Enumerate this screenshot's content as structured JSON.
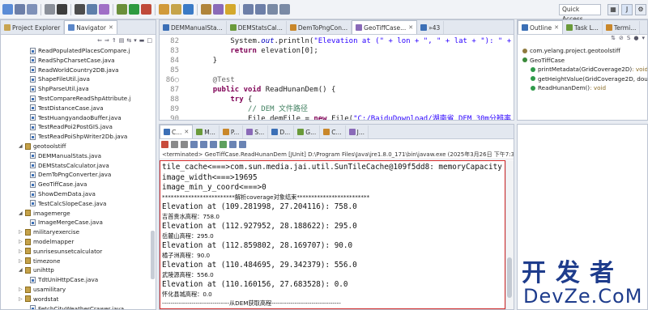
{
  "toolbar": {
    "quick_access": "Quick Access"
  },
  "left_panel": {
    "tabs": [
      {
        "label": "Project Explorer",
        "close": ""
      },
      {
        "label": "Navigator",
        "close": "✕"
      }
    ],
    "tree": [
      {
        "label": "ReadPopulatedPlacesCompare.j",
        "kind": "file",
        "indent": 1
      },
      {
        "label": "ReadShpCharsetCase.java",
        "kind": "file",
        "indent": 1
      },
      {
        "label": "ReadWorldCountry2DB.java",
        "kind": "file",
        "indent": 1
      },
      {
        "label": "ShapeFileUtil.java",
        "kind": "file",
        "indent": 1
      },
      {
        "label": "ShpParseUtil.java",
        "kind": "file",
        "indent": 1
      },
      {
        "label": "TestCompareReadShpAttribute.j",
        "kind": "file",
        "indent": 1
      },
      {
        "label": "TestDistanceCase.java",
        "kind": "file",
        "indent": 1
      },
      {
        "label": "TestHuangyandaoBuffer.java",
        "kind": "file",
        "indent": 1
      },
      {
        "label": "TestReadPoi2PostGIS.java",
        "kind": "file",
        "indent": 1
      },
      {
        "label": "TestReadPoiShpWriter2Db.java",
        "kind": "file",
        "indent": 1
      },
      {
        "label": "geotoolstiff",
        "kind": "folder-open",
        "indent": 0
      },
      {
        "label": "DEMManualStats.java",
        "kind": "file",
        "indent": 1
      },
      {
        "label": "DEMStatsCalculator.java",
        "kind": "file",
        "indent": 1
      },
      {
        "label": "DemToPngConverter.java",
        "kind": "file",
        "indent": 1
      },
      {
        "label": "GeoTiffCase.java",
        "kind": "file",
        "indent": 1
      },
      {
        "label": "ShowDemData.java",
        "kind": "file",
        "indent": 1
      },
      {
        "label": "TestCalcSlopeCase.java",
        "kind": "file",
        "indent": 1
      },
      {
        "label": "imagemerge",
        "kind": "folder-open",
        "indent": 0
      },
      {
        "label": "ImageMergeCase.java",
        "kind": "file",
        "indent": 1
      },
      {
        "label": "militaryexercise",
        "kind": "folder",
        "indent": 0
      },
      {
        "label": "modelmapper",
        "kind": "folder",
        "indent": 0
      },
      {
        "label": "sunrisesunsetcalculator",
        "kind": "folder",
        "indent": 0
      },
      {
        "label": "timezone",
        "kind": "folder",
        "indent": 0
      },
      {
        "label": "unihttp",
        "kind": "folder-open",
        "indent": 0
      },
      {
        "label": "TdtUniHttpCase.java",
        "kind": "file",
        "indent": 1
      },
      {
        "label": "usamilitary",
        "kind": "folder",
        "indent": 0
      },
      {
        "label": "wordstat",
        "kind": "folder",
        "indent": 0
      },
      {
        "label": "FetchCityWeatherCrawer.java",
        "kind": "file",
        "indent": 1
      }
    ]
  },
  "editor": {
    "tabs": [
      {
        "label": "DEMManualSta...",
        "close": ""
      },
      {
        "label": "DEMStatsCal...",
        "close": ""
      },
      {
        "label": "DemToPngCon...",
        "close": ""
      },
      {
        "label": "GeoTiffCase...",
        "close": "✕"
      },
      {
        "label": "»43",
        "close": ""
      }
    ],
    "lines": [
      {
        "n": "82",
        "parts": [
          [
            "",
            "        System."
          ],
          [
            "fld",
            "out"
          ],
          [
            "",
            ".println("
          ],
          [
            "str",
            "\"Elevation at (\" + lon + \", \" + lat + \"): \" +"
          ]
        ]
      },
      {
        "n": "83",
        "parts": [
          [
            "",
            "        "
          ],
          [
            "kw",
            "return"
          ],
          [
            "",
            " elevation[0];"
          ]
        ]
      },
      {
        "n": "84",
        "parts": [
          [
            "",
            "    }"
          ]
        ]
      },
      {
        "n": "85",
        "parts": [
          [
            "",
            ""
          ]
        ]
      },
      {
        "n": "86○",
        "parts": [
          [
            "ann",
            "    @Test"
          ]
        ]
      },
      {
        "n": "87",
        "parts": [
          [
            "",
            "    "
          ],
          [
            "kw",
            "public void"
          ],
          [
            "",
            " ReadHunanDem() {"
          ]
        ]
      },
      {
        "n": "88",
        "parts": [
          [
            "",
            "        "
          ],
          [
            "kw",
            "try"
          ],
          [
            "",
            " {"
          ]
        ]
      },
      {
        "n": "89",
        "parts": [
          [
            "cmt",
            "            // DEM 文件路径"
          ]
        ]
      },
      {
        "n": "90",
        "parts": [
          [
            "",
            "            File demFile = "
          ],
          [
            "kw",
            "new"
          ],
          [
            "",
            " File("
          ],
          [
            "str",
            "\"C:/BaiduDownload/湖南省_DEM_30m分辨率_NA"
          ]
        ]
      }
    ]
  },
  "outline": {
    "tabs": [
      {
        "label": "Outline",
        "close": "✕"
      },
      {
        "label": "Task L...",
        "close": ""
      },
      {
        "label": "Termi...",
        "close": ""
      }
    ],
    "items": [
      {
        "label": "com.yelang.project.geotoolstiff",
        "type": "",
        "indent": 0,
        "color": "#8f7a3e"
      },
      {
        "label": "GeoTiffCase",
        "type": "",
        "indent": 0,
        "color": "#3a8a3a"
      },
      {
        "label": "printMetadata(GridCoverage2D)",
        "type": " : void",
        "indent": 1,
        "color": "#2f9a4a"
      },
      {
        "label": "getHeightValue(GridCoverage2D, double)",
        "type": "",
        "indent": 1,
        "color": "#2f9a4a"
      },
      {
        "label": "ReadHunanDem()",
        "type": " : void",
        "indent": 1,
        "color": "#2f9a4a"
      }
    ]
  },
  "console": {
    "tabs": [
      {
        "label": "C...",
        "close": "✕"
      },
      {
        "label": "M...",
        "close": ""
      },
      {
        "label": "P...",
        "close": ""
      },
      {
        "label": "S...",
        "close": ""
      },
      {
        "label": "D...",
        "close": ""
      },
      {
        "label": "G...",
        "close": ""
      },
      {
        "label": "C...",
        "close": ""
      },
      {
        "label": "J...",
        "close": ""
      }
    ],
    "status": "<terminated> GeoTiffCase.ReadHunanDem [JUnit] D:\\Program Files\\Java\\jre1.8.0_171\\bin\\javaw.exe (2025年3月26日 下午7:39:44",
    "lines": [
      {
        "t": "tile_cache<===>com.sun.media.jai.util.SunTileCache@109f5dd8: memoryCapacity = 10",
        "s": "big"
      },
      {
        "t": "image_width<===>19695",
        "s": "big"
      },
      {
        "t": "image_min_y_coord<===>0",
        "s": "big"
      },
      {
        "t": "*************************解析coverage对象结束*************************",
        "s": "small"
      },
      {
        "t": "Elevation at (109.281998, 27.204116): 758.0",
        "s": "big"
      },
      {
        "t": "吉首贵水高程：758.0",
        "s": "small"
      },
      {
        "t": "Elevation at (112.927952, 28.188622): 295.0",
        "s": "big"
      },
      {
        "t": "岳麓山高程：295.0",
        "s": "small"
      },
      {
        "t": "Elevation at (112.859802, 28.169707): 90.0",
        "s": "big"
      },
      {
        "t": "橘子洲高程：90.0",
        "s": "small"
      },
      {
        "t": "Elevation at (110.484695, 29.342379): 556.0",
        "s": "big"
      },
      {
        "t": "武陵源高程：556.0",
        "s": "small"
      },
      {
        "t": "Elevation at (110.160156, 27.683528): 0.0",
        "s": "big"
      },
      {
        "t": "怀化县城高程：0.0",
        "s": "small"
      },
      {
        "t": "--------------------------------从DEM获取高程---------------------------------",
        "s": "small"
      }
    ]
  },
  "watermark": {
    "cn": "开发者",
    "en": "DevZe.CoM"
  }
}
